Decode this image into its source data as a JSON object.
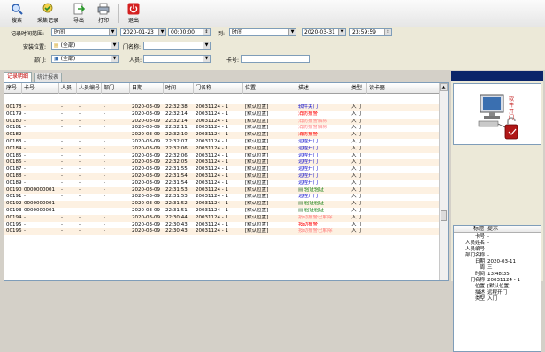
{
  "toolbar": {
    "buttons": [
      {
        "label": "搜索",
        "icon": "search-icon"
      },
      {
        "label": "采集记录",
        "icon": "collect-icon"
      },
      {
        "label": "导出",
        "icon": "export-icon"
      },
      {
        "label": "打印",
        "icon": "print-icon"
      },
      {
        "label": "退出",
        "icon": "power-icon"
      }
    ]
  },
  "filters": {
    "time_range_label": "记录时间范围:",
    "time_range_value": "时间",
    "start_date": "2020-01-23",
    "start_time": "00:00:00",
    "to_label": "到:",
    "to_value": "时间",
    "end_date": "2020-03-31",
    "end_time": "23:59:59",
    "install_location_label": "安装位置:",
    "install_location_value": "(全部)",
    "door_name_label": "门名称:",
    "door_name_value": "",
    "department_label": "部门:",
    "department_value": "(全部)",
    "person_label": "人员:",
    "person_value": "",
    "card_label": "卡号:",
    "card_value": ""
  },
  "tabs": [
    "记录明细",
    "统计报表"
  ],
  "grid": {
    "columns": [
      "序号",
      "卡号",
      "人员",
      "人员编号",
      "部门",
      "日期",
      "时间",
      "门名称",
      "位置",
      "描述",
      "类型",
      "读卡器"
    ],
    "rows": [
      {
        "seq": "00178",
        "card": "-",
        "person": "-",
        "pid": "-",
        "dept": "-",
        "date": "2020-03-09",
        "time": "22:32:38",
        "door": "20031124 - 1",
        "loc": "[默认位置]",
        "desc": "软件关门",
        "desc_color": "#0000cc",
        "desc_icon": false,
        "type": "入门",
        "reader": ""
      },
      {
        "seq": "00179",
        "card": "-",
        "person": "-",
        "pid": "-",
        "dept": "-",
        "date": "2020-03-09",
        "time": "22:32:14",
        "door": "20031124 - 1",
        "loc": "[默认位置]",
        "desc": "消防报警",
        "desc_color": "#ff0000",
        "desc_icon": false,
        "type": "入门",
        "reader": ""
      },
      {
        "seq": "00180",
        "card": "-",
        "person": "-",
        "pid": "-",
        "dept": "-",
        "date": "2020-03-09",
        "time": "22:32:14",
        "door": "20031124 - 1",
        "loc": "[默认位置]",
        "desc": "消防报警解除",
        "desc_color": "#ff7f7f",
        "desc_icon": false,
        "type": "入门",
        "reader": ""
      },
      {
        "seq": "00181",
        "card": "-",
        "person": "-",
        "pid": "-",
        "dept": "-",
        "date": "2020-03-09",
        "time": "22:32:11",
        "door": "20031124 - 1",
        "loc": "[默认位置]",
        "desc": "消防报警解除",
        "desc_color": "#ff7f7f",
        "desc_icon": false,
        "type": "入门",
        "reader": ""
      },
      {
        "seq": "00182",
        "card": "-",
        "person": "-",
        "pid": "-",
        "dept": "-",
        "date": "2020-03-09",
        "time": "22:32:10",
        "door": "20031124 - 1",
        "loc": "[默认位置]",
        "desc": "消防报警",
        "desc_color": "#ff0000",
        "desc_icon": false,
        "type": "入门",
        "reader": ""
      },
      {
        "seq": "00183",
        "card": "-",
        "person": "-",
        "pid": "-",
        "dept": "-",
        "date": "2020-03-09",
        "time": "22:32:07",
        "door": "20031124 - 1",
        "loc": "[默认位置]",
        "desc": "远程开门",
        "desc_color": "#0000cc",
        "desc_icon": false,
        "type": "入门",
        "reader": ""
      },
      {
        "seq": "00184",
        "card": "-",
        "person": "-",
        "pid": "-",
        "dept": "-",
        "date": "2020-03-09",
        "time": "22:32:06",
        "door": "20031124 - 1",
        "loc": "[默认位置]",
        "desc": "远程开门",
        "desc_color": "#0000cc",
        "desc_icon": false,
        "type": "入门",
        "reader": ""
      },
      {
        "seq": "00185",
        "card": "-",
        "person": "-",
        "pid": "-",
        "dept": "-",
        "date": "2020-03-09",
        "time": "22:32:06",
        "door": "20031124 - 1",
        "loc": "[默认位置]",
        "desc": "远程开门",
        "desc_color": "#0000cc",
        "desc_icon": false,
        "type": "入门",
        "reader": ""
      },
      {
        "seq": "00186",
        "card": "-",
        "person": "-",
        "pid": "-",
        "dept": "-",
        "date": "2020-03-09",
        "time": "22:32:05",
        "door": "20031124 - 1",
        "loc": "[默认位置]",
        "desc": "远程开门",
        "desc_color": "#0000cc",
        "desc_icon": false,
        "type": "入门",
        "reader": ""
      },
      {
        "seq": "00187",
        "card": "-",
        "person": "-",
        "pid": "-",
        "dept": "-",
        "date": "2020-03-09",
        "time": "22:31:55",
        "door": "20031124 - 1",
        "loc": "[默认位置]",
        "desc": "远程开门",
        "desc_color": "#0000cc",
        "desc_icon": false,
        "type": "入门",
        "reader": ""
      },
      {
        "seq": "00188",
        "card": "-",
        "person": "-",
        "pid": "-",
        "dept": "-",
        "date": "2020-03-09",
        "time": "22:31:54",
        "door": "20031124 - 1",
        "loc": "[默认位置]",
        "desc": "远程开门",
        "desc_color": "#0000cc",
        "desc_icon": false,
        "type": "入门",
        "reader": ""
      },
      {
        "seq": "00189",
        "card": "-",
        "person": "-",
        "pid": "-",
        "dept": "-",
        "date": "2020-03-09",
        "time": "22:31:54",
        "door": "20031124 - 1",
        "loc": "[默认位置]",
        "desc": "远程开门",
        "desc_color": "#0000cc",
        "desc_icon": false,
        "type": "入门",
        "reader": ""
      },
      {
        "seq": "00190",
        "card": "0000000001",
        "person": "-",
        "pid": "-",
        "dept": "-",
        "date": "2020-03-09",
        "time": "22:31:53",
        "door": "20031124 - 1",
        "loc": "[默认位置]",
        "desc": "验证验证",
        "desc_color": "#007700",
        "desc_icon": true,
        "type": "入门",
        "reader": ""
      },
      {
        "seq": "00191",
        "card": "-",
        "person": "-",
        "pid": "-",
        "dept": "-",
        "date": "2020-03-09",
        "time": "22:31:53",
        "door": "20031124 - 1",
        "loc": "[默认位置]",
        "desc": "远程开门",
        "desc_color": "#0000cc",
        "desc_icon": false,
        "type": "入门",
        "reader": ""
      },
      {
        "seq": "00192",
        "card": "0000000001",
        "person": "-",
        "pid": "-",
        "dept": "-",
        "date": "2020-03-09",
        "time": "22:31:52",
        "door": "20031124 - 1",
        "loc": "[默认位置]",
        "desc": "验证验证",
        "desc_color": "#007700",
        "desc_icon": true,
        "type": "入门",
        "reader": ""
      },
      {
        "seq": "00193",
        "card": "0000000001",
        "person": "-",
        "pid": "-",
        "dept": "-",
        "date": "2020-03-09",
        "time": "22:31:51",
        "door": "20031124 - 1",
        "loc": "[默认位置]",
        "desc": "验证验证",
        "desc_color": "#007700",
        "desc_icon": true,
        "type": "入门",
        "reader": ""
      },
      {
        "seq": "00194",
        "card": "-",
        "person": "-",
        "pid": "-",
        "dept": "-",
        "date": "2020-03-09",
        "time": "22:30:44",
        "door": "20031124 - 1",
        "loc": "[默认位置]",
        "desc": "按动报警已解除",
        "desc_color": "#ff7f7f",
        "desc_icon": false,
        "type": "入门",
        "reader": ""
      },
      {
        "seq": "00195",
        "card": "-",
        "person": "-",
        "pid": "-",
        "dept": "-",
        "date": "2020-03-09",
        "time": "22:30:43",
        "door": "20031124 - 1",
        "loc": "[默认位置]",
        "desc": "按动报警",
        "desc_color": "#ff0000",
        "desc_icon": false,
        "type": "入门",
        "reader": ""
      },
      {
        "seq": "00196",
        "card": "-",
        "person": "-",
        "pid": "-",
        "dept": "-",
        "date": "2020-03-09",
        "time": "22:30:43",
        "door": "20031124 - 1",
        "loc": "[默认位置]",
        "desc": "按动报警已解除",
        "desc_color": "#ff7f7f",
        "desc_icon": false,
        "type": "入门",
        "reader": ""
      }
    ]
  },
  "side": {
    "photo_caption": "软件开门",
    "detail_header": {
      "k": "标题",
      "v": "提示"
    },
    "detail": [
      {
        "k": "卡号",
        "v": "-"
      },
      {
        "k": "人员姓名",
        "v": "-"
      },
      {
        "k": "人员编号",
        "v": "-"
      },
      {
        "k": "部门名称",
        "v": "-"
      },
      {
        "k": "日期",
        "v": "2020-03-11"
      },
      {
        "k": "周",
        "v": "三"
      },
      {
        "k": "时间",
        "v": "13:48:35"
      },
      {
        "k": "门名称",
        "v": "20031124 - 1"
      },
      {
        "k": "位置",
        "v": "[默认位置]"
      },
      {
        "k": "描述",
        "v": "远程开门"
      },
      {
        "k": "类型",
        "v": "入门"
      }
    ]
  },
  "colors": {
    "row_alt": "#fdf1e2",
    "row": "#ffffff",
    "accent": "#c00000"
  }
}
